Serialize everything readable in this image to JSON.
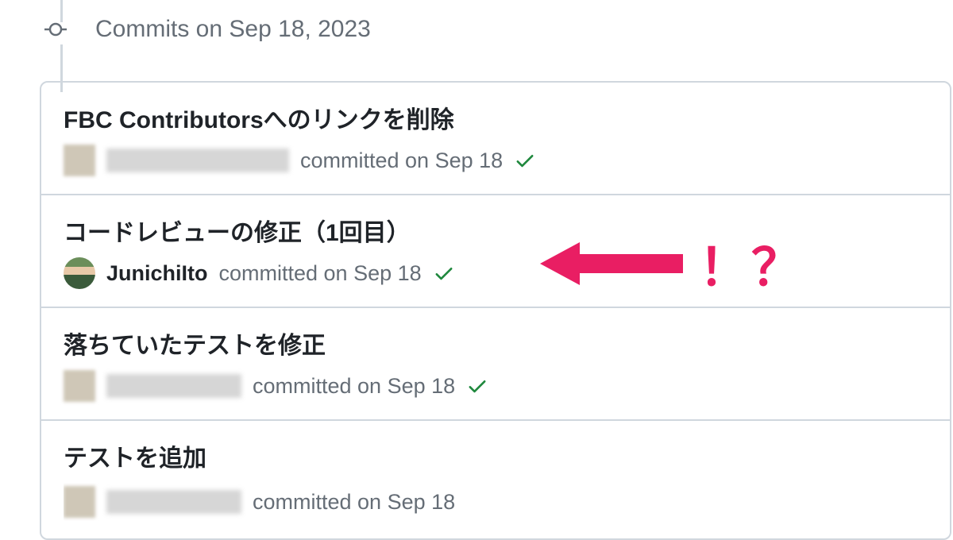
{
  "timeline": {
    "date_label": "Commits on Sep 18, 2023"
  },
  "commits": [
    {
      "title": "FBC Contributorsへのリンクを削除",
      "author": "",
      "author_redacted": true,
      "committed_text": "committed on Sep 18",
      "verified": true
    },
    {
      "title": "コードレビューの修正（1回目）",
      "author": "JunichiIto",
      "author_redacted": false,
      "committed_text": "committed on Sep 18",
      "verified": true
    },
    {
      "title": "落ちていたテストを修正",
      "author": "",
      "author_redacted": true,
      "committed_text": "committed on Sep 18",
      "verified": true
    },
    {
      "title": "テストを追加",
      "author": "",
      "author_redacted": true,
      "committed_text": "committed on Sep 18",
      "verified": true
    }
  ],
  "annotation": {
    "text": "！？"
  },
  "colors": {
    "accent_pink": "#e91e63",
    "success_green": "#1f883d",
    "border_gray": "#d0d7de",
    "muted_text": "#656d76"
  }
}
